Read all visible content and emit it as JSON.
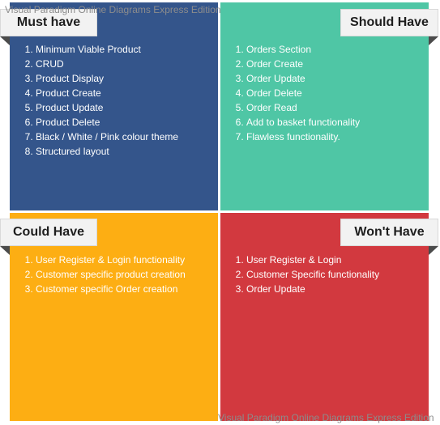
{
  "watermark": {
    "top": "Visual Paradigm Online Diagrams Express Edition",
    "bottom": "Visual Paradigm Online Diagrams Express Edition"
  },
  "colors": {
    "must_have": "#34558b",
    "should_have": "#4fc6a5",
    "could_have": "#fdae13",
    "wont_have": "#d2393f"
  },
  "quadrants": {
    "must_have": {
      "title": "Must have",
      "items": [
        "Minimum Viable Product",
        "CRUD",
        "Product Display",
        "Product Create",
        "Product Update",
        "Product Delete",
        "Black / White / Pink colour theme",
        "Structured layout"
      ]
    },
    "should_have": {
      "title": "Should Have",
      "items": [
        "Orders Section",
        "Order Create",
        "Order Update",
        "Order Delete",
        "Order Read",
        "Add to basket functionality",
        "Flawless functionality."
      ]
    },
    "could_have": {
      "title": "Could Have",
      "items": [
        "User Register & Login functionality",
        "Customer specific product creation",
        "Customer specific Order creation"
      ]
    },
    "wont_have": {
      "title": "Won't Have",
      "items": [
        "User Register & Login",
        "Customer Specific functionality",
        "Order Update"
      ]
    }
  }
}
